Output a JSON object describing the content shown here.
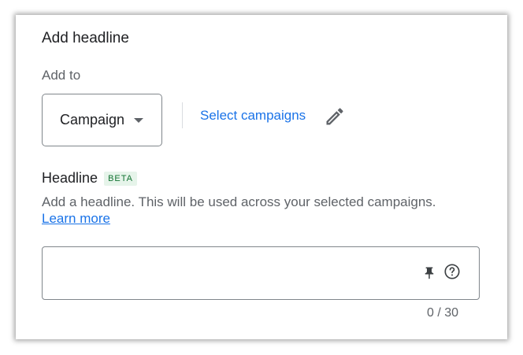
{
  "panel": {
    "title": "Add headline",
    "add_to_label": "Add to",
    "dropdown_value": "Campaign",
    "select_campaigns_link": "Select campaigns",
    "headline_label": "Headline",
    "beta_badge": "BETA",
    "helper_text": "Add a headline. This will be used across your selected campaigns.",
    "learn_more_link": "Learn more",
    "input_value": "",
    "char_counter": "0 / 30"
  },
  "icons": {
    "dropdown": "caret-down-icon",
    "edit": "pencil-icon",
    "pin": "pin-icon",
    "help": "help-circle-icon"
  },
  "colors": {
    "link": "#1a73e8",
    "beta_bg": "#e6f4ea",
    "beta_text": "#137333"
  }
}
